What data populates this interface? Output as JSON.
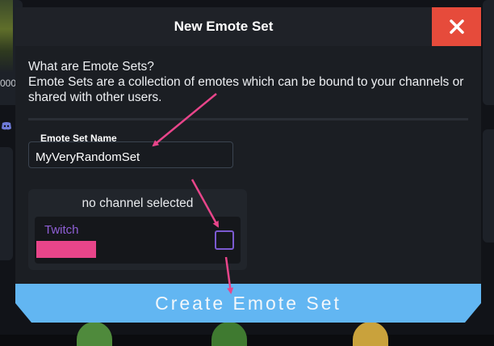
{
  "modal": {
    "title": "New Emote Set",
    "close_icon": "close-icon",
    "intro_heading": "What are Emote Sets?",
    "intro_text": "Emote Sets are a collection of emotes which can be bound to your channels or shared with other users."
  },
  "form": {
    "name_label": "Emote Set Name",
    "name_value": "MyVeryRandomSet"
  },
  "channel": {
    "status": "no channel selected",
    "platform": "Twitch",
    "selected": false
  },
  "actions": {
    "create_label": "Create Emote Set"
  },
  "background": {
    "partial_count": "000",
    "icons": [
      "discord-icon"
    ]
  },
  "colors": {
    "close_button": "#e64b3b",
    "create_button": "#62b6f2",
    "twitch_purple": "#8f5fd6",
    "annotation_arrow": "#e8458a"
  }
}
